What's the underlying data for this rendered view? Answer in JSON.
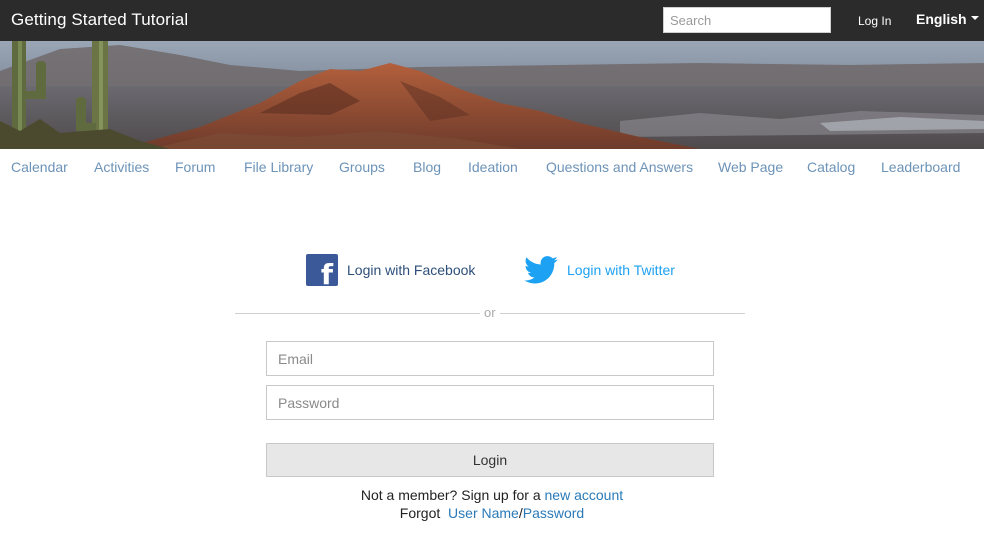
{
  "header": {
    "site_title": "Getting Started Tutorial",
    "search_placeholder": "Search",
    "login_label": "Log In",
    "language": "English"
  },
  "nav": {
    "items": [
      {
        "label": "Calendar"
      },
      {
        "label": "Activities"
      },
      {
        "label": "Forum"
      },
      {
        "label": "File Library"
      },
      {
        "label": "Groups"
      },
      {
        "label": "Blog"
      },
      {
        "label": "Ideation"
      },
      {
        "label": "Questions and Answers"
      },
      {
        "label": "Web Page"
      },
      {
        "label": "Catalog"
      },
      {
        "label": "Leaderboard"
      }
    ]
  },
  "social": {
    "facebook_label": "Login with Facebook",
    "twitter_label": "Login with Twitter",
    "facebook_color": "#3b5998",
    "twitter_color": "#1da1f2"
  },
  "divider": {
    "text": "or"
  },
  "form": {
    "email_placeholder": "Email",
    "password_placeholder": "Password",
    "login_button": "Login"
  },
  "footer": {
    "not_member": "Not a member? Sign up for a",
    "new_account": "new account",
    "forgot": "Forgot",
    "user_name": "User Name",
    "slash": "/",
    "password": "Password"
  },
  "theme": {
    "topbar_bg": "#2b2b2b",
    "nav_link": "#6d93b8",
    "link": "#2a7ab8"
  }
}
